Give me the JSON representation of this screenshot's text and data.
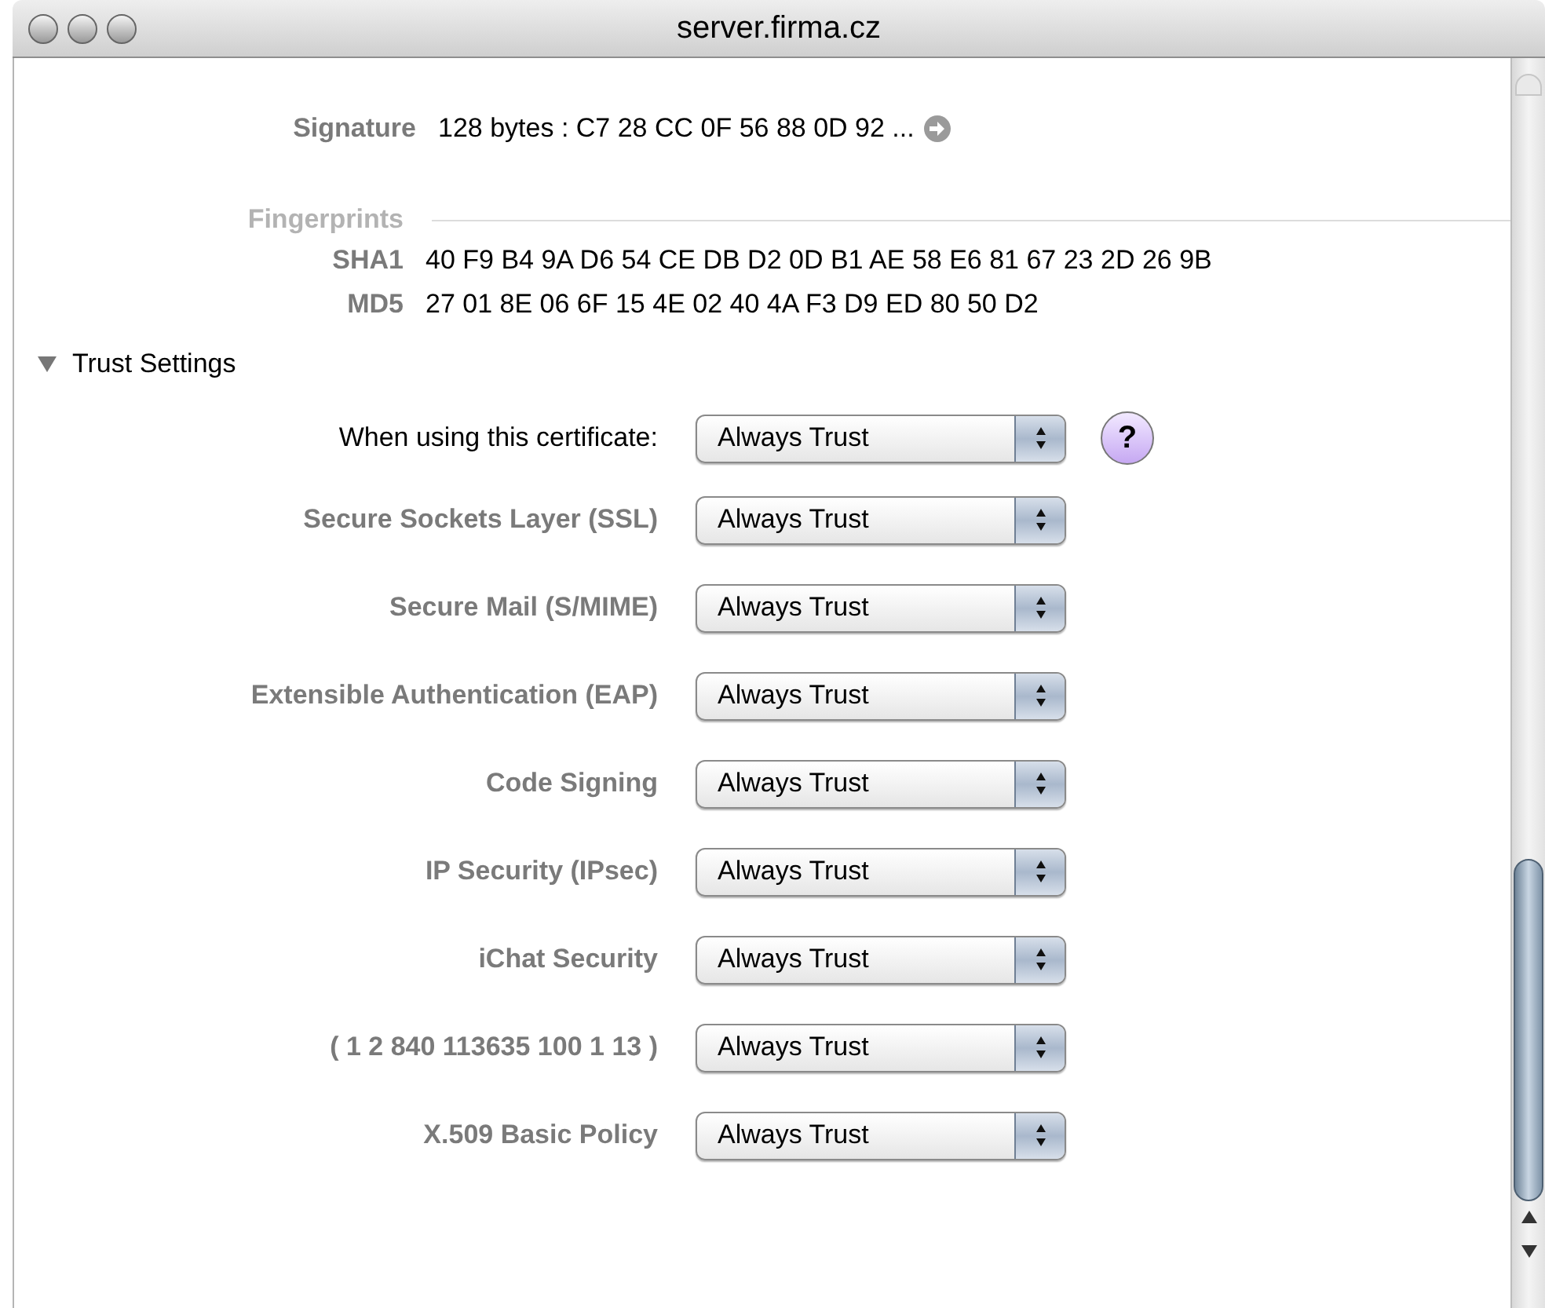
{
  "window": {
    "title": "server.firma.cz"
  },
  "signature": {
    "label": "Signature",
    "value": "128 bytes : C7 28 CC 0F 56 88 0D 92 ..."
  },
  "fingerprints": {
    "heading": "Fingerprints",
    "items": [
      {
        "label": "SHA1",
        "value": "40 F9 B4 9A D6 54 CE DB D2 0D B1 AE 58 E6 81 67 23 2D 26 9B"
      },
      {
        "label": "MD5",
        "value": "27 01 8E 06 6F 15 4E 02 40 4A F3 D9 ED 80 50 D2"
      }
    ]
  },
  "trust_settings": {
    "title": "Trust Settings",
    "expanded": true,
    "main": {
      "label": "When using this certificate:",
      "value": "Always Trust",
      "help": "?"
    },
    "policies": [
      {
        "label": "Secure Sockets Layer (SSL)",
        "value": "Always Trust"
      },
      {
        "label": "Secure Mail (S/MIME)",
        "value": "Always Trust"
      },
      {
        "label": "Extensible Authentication (EAP)",
        "value": "Always Trust"
      },
      {
        "label": "Code Signing",
        "value": "Always Trust"
      },
      {
        "label": "IP Security (IPsec)",
        "value": "Always Trust"
      },
      {
        "label": "iChat Security",
        "value": "Always Trust"
      },
      {
        "label": "( 1 2 840 113635 100 1 13 )",
        "value": "Always Trust"
      },
      {
        "label": "X.509 Basic Policy",
        "value": "Always Trust"
      }
    ]
  }
}
